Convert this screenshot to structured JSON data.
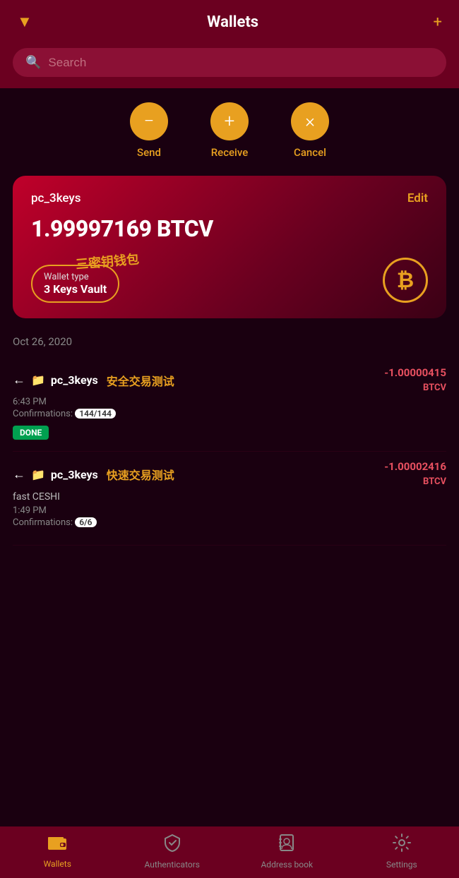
{
  "header": {
    "title": "Wallets",
    "filter_icon": "▼",
    "add_icon": "+"
  },
  "search": {
    "placeholder": "Search"
  },
  "actions": [
    {
      "id": "send",
      "icon": "−",
      "label": "Send"
    },
    {
      "id": "receive",
      "icon": "+",
      "label": "Receive"
    },
    {
      "id": "cancel",
      "icon": "×",
      "label": "Cancel"
    }
  ],
  "wallet_card": {
    "name": "pc_3keys",
    "edit_label": "Edit",
    "balance": "1.99997169 BTCV",
    "type_label": "Wallet type",
    "type_value": "3 Keys Vault",
    "type_annotation": "三密钥钱包",
    "btc_symbol": "₿"
  },
  "tx_date": "Oct 26, 2020",
  "transactions": [
    {
      "id": "tx1",
      "direction": "←",
      "wallet": "pc_3keys",
      "annotation": "安全交易测试",
      "time": "6:43 PM",
      "confirmations_label": "Confirmations:",
      "confirmations": "144/144",
      "status": "DONE",
      "amount": "-1.00000415",
      "currency": "BTCV"
    },
    {
      "id": "tx2",
      "direction": "←",
      "wallet": "pc_3keys",
      "annotation": "快速交易测试",
      "sub_label": "fast CESHI",
      "time": "1:49 PM",
      "confirmations_label": "Confirmations:",
      "confirmations": "6/6",
      "status": null,
      "amount": "-1.00002416",
      "currency": "BTCV"
    }
  ],
  "bottom_nav": [
    {
      "id": "wallets",
      "icon": "wallet",
      "label": "Wallets",
      "active": true
    },
    {
      "id": "authenticators",
      "icon": "shield",
      "label": "Authenticators",
      "active": false
    },
    {
      "id": "address-book",
      "icon": "contacts",
      "label": "Address book",
      "active": false
    },
    {
      "id": "settings",
      "icon": "gear",
      "label": "Settings",
      "active": false
    }
  ]
}
